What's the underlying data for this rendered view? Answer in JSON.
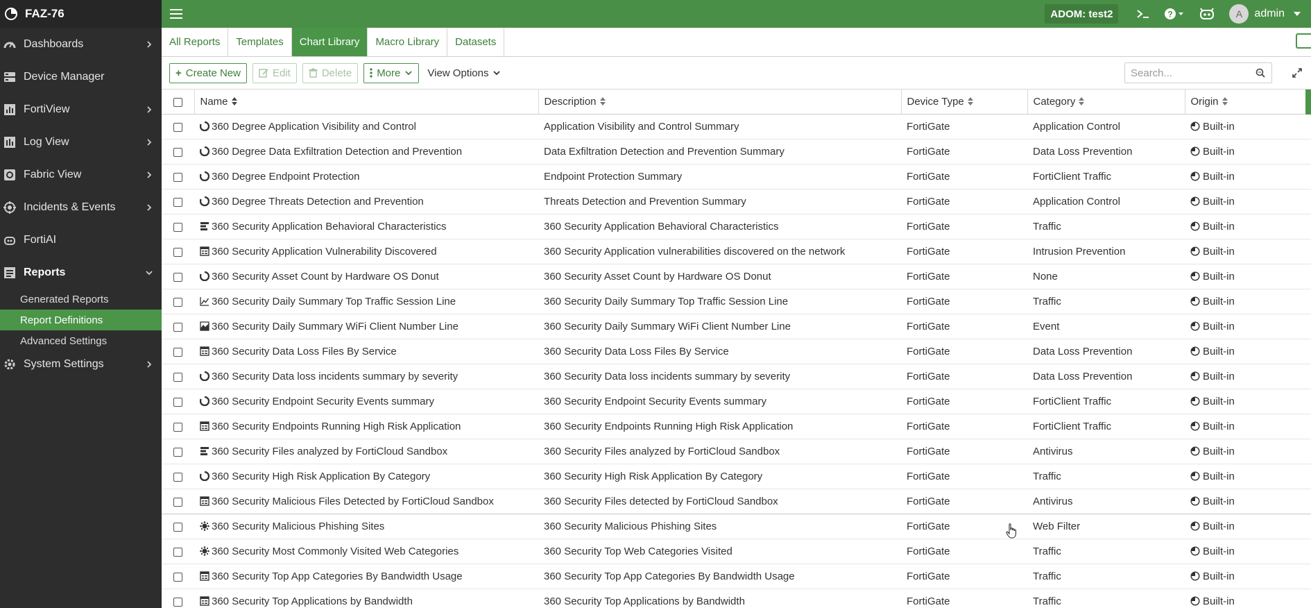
{
  "app": {
    "title": "FAZ-76"
  },
  "sidebar": {
    "items": [
      {
        "label": "Dashboards",
        "icon": "dashboard-icon",
        "has_children": true
      },
      {
        "label": "Device Manager",
        "icon": "device-manager-icon",
        "has_children": false
      },
      {
        "label": "FortiView",
        "icon": "fortiview-icon",
        "has_children": true
      },
      {
        "label": "Log View",
        "icon": "log-view-icon",
        "has_children": true
      },
      {
        "label": "Fabric View",
        "icon": "fabric-view-icon",
        "has_children": true
      },
      {
        "label": "Incidents & Events",
        "icon": "incidents-icon",
        "has_children": true
      },
      {
        "label": "FortiAI",
        "icon": "fortiai-icon",
        "has_children": false
      },
      {
        "label": "Reports",
        "icon": "reports-icon",
        "has_children": true,
        "expanded": true
      }
    ],
    "reports_children": [
      {
        "label": "Generated Reports"
      },
      {
        "label": "Report Definitions",
        "active": true
      },
      {
        "label": "Advanced Settings"
      }
    ],
    "system_settings": {
      "label": "System Settings",
      "icon": "gear-icon"
    }
  },
  "topbar": {
    "adom_label": "ADOM: test2",
    "user_initial": "A",
    "user_name": "admin"
  },
  "tabs": [
    {
      "label": "All Reports"
    },
    {
      "label": "Templates"
    },
    {
      "label": "Chart Library",
      "active": true
    },
    {
      "label": "Macro Library"
    },
    {
      "label": "Datasets"
    }
  ],
  "toolbar": {
    "create_label": "Create New",
    "edit_label": "Edit",
    "delete_label": "Delete",
    "more_label": "More",
    "view_options_label": "View Options",
    "search_placeholder": "Search..."
  },
  "table": {
    "columns": [
      "Name",
      "Description",
      "Device Type",
      "Category",
      "Origin"
    ],
    "rows": [
      {
        "icon": "donut",
        "name": "360 Degree Application Visibility and Control",
        "description": "Application Visibility and Control Summary",
        "device": "FortiGate",
        "category": "Application Control",
        "origin": "Built-in"
      },
      {
        "icon": "donut",
        "name": "360 Degree Data Exfiltration Detection and Prevention",
        "description": "Data Exfiltration Detection and Prevention Summary",
        "device": "FortiGate",
        "category": "Data Loss Prevention",
        "origin": "Built-in"
      },
      {
        "icon": "donut",
        "name": "360 Degree Endpoint Protection",
        "description": "Endpoint Protection Summary",
        "device": "FortiGate",
        "category": "FortiClient Traffic",
        "origin": "Built-in"
      },
      {
        "icon": "donut",
        "name": "360 Degree Threats Detection and Prevention",
        "description": "Threats Detection and Prevention Summary",
        "device": "FortiGate",
        "category": "Application Control",
        "origin": "Built-in"
      },
      {
        "icon": "bar",
        "name": "360 Security Application Behavioral Characteristics",
        "description": "360 Security Application Behavioral Characteristics",
        "device": "FortiGate",
        "category": "Traffic",
        "origin": "Built-in"
      },
      {
        "icon": "table",
        "name": "360 Security Application Vulnerability Discovered",
        "description": "360 Security Application vulnerabilities discovered on the network",
        "device": "FortiGate",
        "category": "Intrusion Prevention",
        "origin": "Built-in"
      },
      {
        "icon": "donut",
        "name": "360 Security Asset Count by Hardware OS Donut",
        "description": "360 Security Asset Count by Hardware OS Donut",
        "device": "FortiGate",
        "category": "None",
        "origin": "Built-in"
      },
      {
        "icon": "line",
        "name": "360 Security Daily Summary Top Traffic Session Line",
        "description": "360 Security Daily Summary Top Traffic Session Line",
        "device": "FortiGate",
        "category": "Traffic",
        "origin": "Built-in"
      },
      {
        "icon": "area",
        "name": "360 Security Daily Summary WiFi Client Number Line",
        "description": "360 Security Daily Summary WiFi Client Number Line",
        "device": "FortiGate",
        "category": "Event",
        "origin": "Built-in"
      },
      {
        "icon": "table",
        "name": "360 Security Data Loss Files By Service",
        "description": "360 Security Data Loss Files By Service",
        "device": "FortiGate",
        "category": "Data Loss Prevention",
        "origin": "Built-in"
      },
      {
        "icon": "donut",
        "name": "360 Security Data loss incidents summary by severity",
        "description": "360 Security Data loss incidents summary by severity",
        "device": "FortiGate",
        "category": "Data Loss Prevention",
        "origin": "Built-in"
      },
      {
        "icon": "donut",
        "name": "360 Security Endpoint Security Events summary",
        "description": "360 Security Endpoint Security Events summary",
        "device": "FortiGate",
        "category": "FortiClient Traffic",
        "origin": "Built-in"
      },
      {
        "icon": "table",
        "name": "360 Security Endpoints Running High Risk Application",
        "description": "360 Security Endpoints Running High Risk Application",
        "device": "FortiGate",
        "category": "FortiClient Traffic",
        "origin": "Built-in"
      },
      {
        "icon": "bar",
        "name": "360 Security Files analyzed by FortiCloud Sandbox",
        "description": "360 Security Files analyzed by FortiCloud Sandbox",
        "device": "FortiGate",
        "category": "Antivirus",
        "origin": "Built-in"
      },
      {
        "icon": "donut",
        "name": "360 Security High Risk Application By Category",
        "description": "360 Security High Risk Application By Category",
        "device": "FortiGate",
        "category": "Traffic",
        "origin": "Built-in"
      },
      {
        "icon": "table",
        "name": "360 Security Malicious Files Detected by FortiCloud Sandbox",
        "description": "360 Security Files detected by FortiCloud Sandbox",
        "device": "FortiGate",
        "category": "Antivirus",
        "origin": "Built-in"
      },
      {
        "icon": "bubble",
        "name": "360 Security Malicious Phishing Sites",
        "description": "360 Security Malicious Phishing Sites",
        "device": "FortiGate",
        "category": "Web Filter",
        "origin": "Built-in"
      },
      {
        "icon": "bubble",
        "name": "360 Security Most Commonly Visited Web Categories",
        "description": "360 Security Top Web Categories Visited",
        "device": "FortiGate",
        "category": "Traffic",
        "origin": "Built-in"
      },
      {
        "icon": "table",
        "name": "360 Security Top App Categories By Bandwidth Usage",
        "description": "360 Security Top App Categories By Bandwidth Usage",
        "device": "FortiGate",
        "category": "Traffic",
        "origin": "Built-in"
      },
      {
        "icon": "table",
        "name": "360 Security Top Applications by Bandwidth",
        "description": "360 Security Top Applications by Bandwidth",
        "device": "FortiGate",
        "category": "Traffic",
        "origin": "Built-in"
      }
    ]
  }
}
